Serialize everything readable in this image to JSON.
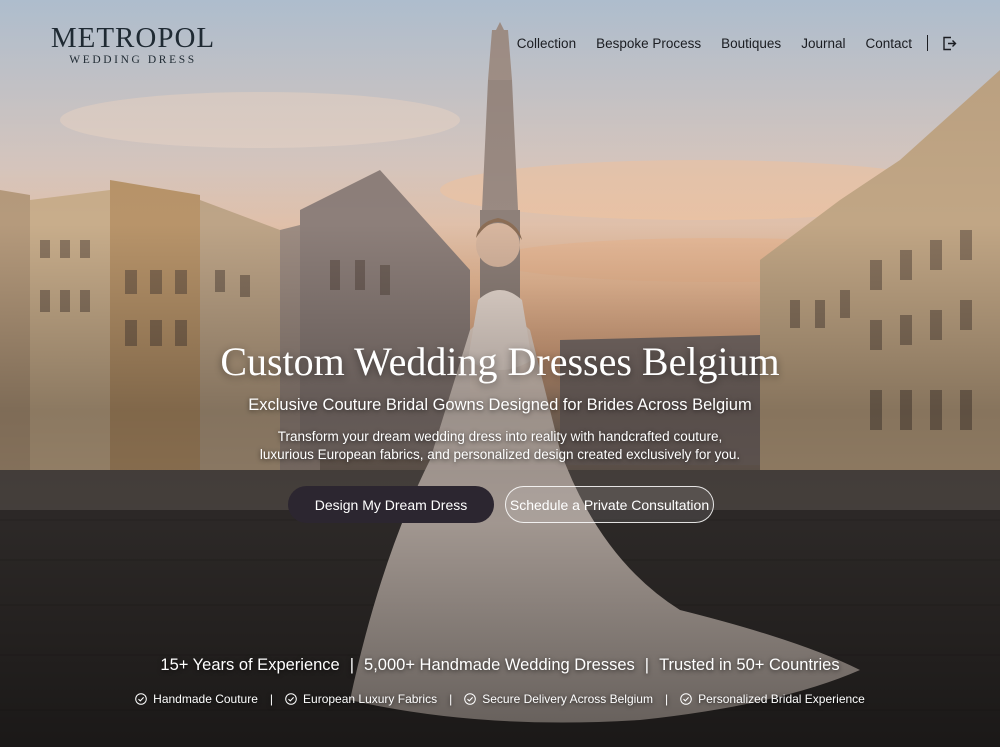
{
  "brand": {
    "name": "METROPOL",
    "tagline": "WEDDING DRESS"
  },
  "nav": {
    "items": [
      "Collection",
      "Bespoke Process",
      "Boutiques",
      "Journal",
      "Contact"
    ],
    "login_icon": "login-icon"
  },
  "hero": {
    "headline": "Custom Wedding Dresses Belgium",
    "subheadline": "Exclusive Couture Bridal Gowns Designed for Brides Across Belgium",
    "description_line1": "Transform your dream wedding dress into reality with handcrafted couture,",
    "description_line2": "luxurious European fabrics, and personalized design created exclusively for you.",
    "cta_primary": "Design My Dream Dress",
    "cta_secondary": "Schedule a Private Consultation"
  },
  "stats": [
    "15+ Years of Experience",
    "5,000+ Handmade Wedding Dresses",
    "Trusted in 50+ Countries"
  ],
  "badges": [
    "Handmade Couture",
    "European Luxury Fabrics",
    "Secure Delivery Across Belgium",
    "Personalized Bridal Experience"
  ],
  "colors": {
    "primary_button": "#2c2630",
    "text_dark": "#1f2a33",
    "text_light": "#ffffff"
  }
}
